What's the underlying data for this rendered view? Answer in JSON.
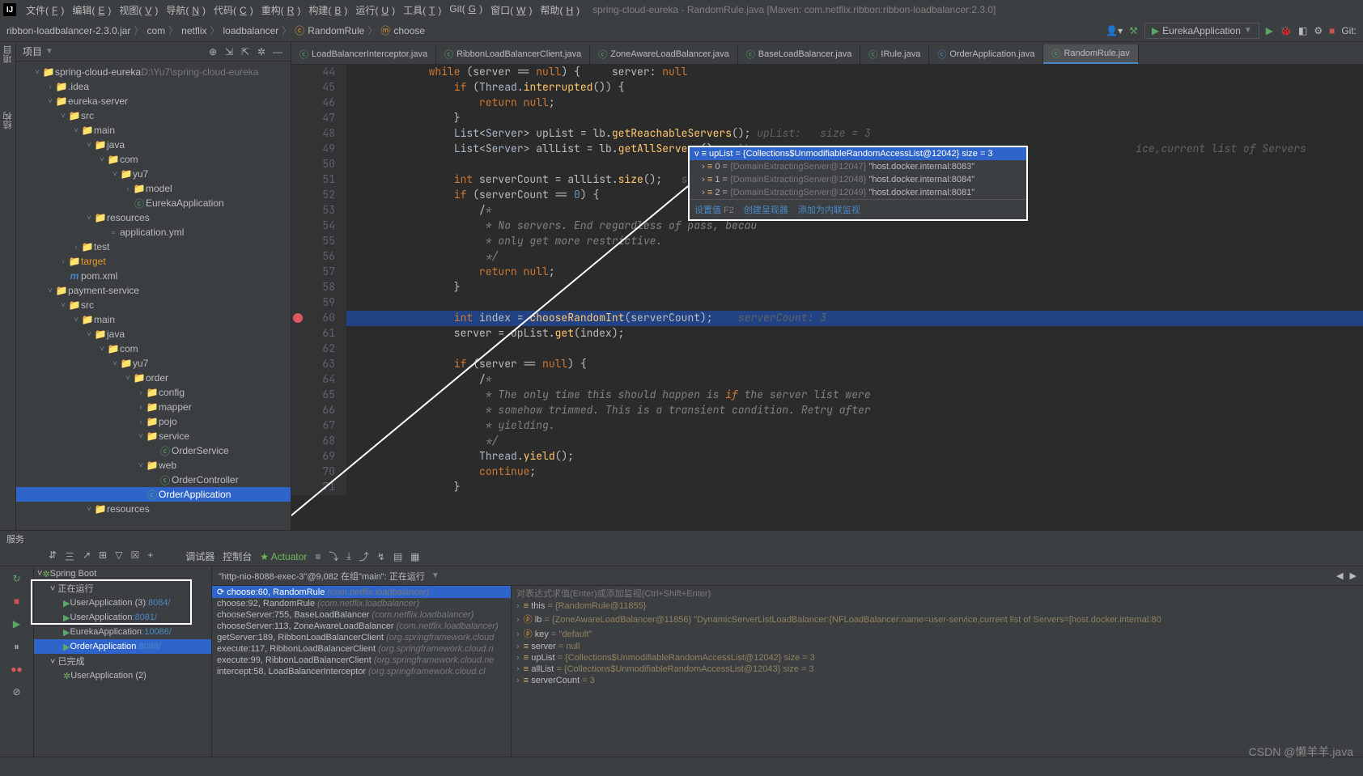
{
  "title": "spring-cloud-eureka - RandomRule.java [Maven: com.netflix.ribbon:ribbon-loadbalancer:2.3.0]",
  "menus": [
    {
      "label": "文件",
      "u": "F"
    },
    {
      "label": "编辑",
      "u": "E"
    },
    {
      "label": "视图",
      "u": "V"
    },
    {
      "label": "导航",
      "u": "N"
    },
    {
      "label": "代码",
      "u": "C"
    },
    {
      "label": "重构",
      "u": "R"
    },
    {
      "label": "构建",
      "u": "B"
    },
    {
      "label": "运行",
      "u": "U"
    },
    {
      "label": "工具",
      "u": "T"
    },
    {
      "label": "Git",
      "u": "G"
    },
    {
      "label": "窗口",
      "u": "W"
    },
    {
      "label": "帮助",
      "u": "H"
    }
  ],
  "breadcrumbs": [
    "ribbon-loadbalancer-2.3.0.jar",
    "com",
    "netflix",
    "loadbalancer",
    "RandomRule",
    "choose"
  ],
  "run_config": "EurekaApplication",
  "nav_right_git": "Git:",
  "project_panel_title": "项目",
  "project_root": {
    "name": "spring-cloud-eureka",
    "path": "D:\\Yu7\\spring-cloud-eureka"
  },
  "tree": [
    {
      "ind": 0,
      "arr": "v",
      "icon": "folder-blue",
      "label": "spring-cloud-eureka",
      "suffix": "D:\\Yu7\\spring-cloud-eureka"
    },
    {
      "ind": 1,
      "arr": ">",
      "icon": "folder",
      "label": ".idea"
    },
    {
      "ind": 1,
      "arr": "v",
      "icon": "folder-blue",
      "label": "eureka-server"
    },
    {
      "ind": 2,
      "arr": "v",
      "icon": "folder",
      "label": "src"
    },
    {
      "ind": 3,
      "arr": "v",
      "icon": "folder-blue",
      "label": "main"
    },
    {
      "ind": 4,
      "arr": "v",
      "icon": "folder-blue",
      "label": "java"
    },
    {
      "ind": 5,
      "arr": "v",
      "icon": "folder",
      "label": "com"
    },
    {
      "ind": 6,
      "arr": "v",
      "icon": "folder",
      "label": "yu7"
    },
    {
      "ind": 7,
      "arr": ">",
      "icon": "folder",
      "label": "model"
    },
    {
      "ind": 7,
      "arr": "",
      "icon": "class-run",
      "label": "EurekaApplication"
    },
    {
      "ind": 4,
      "arr": "v",
      "icon": "folder-blue",
      "label": "resources"
    },
    {
      "ind": 5,
      "arr": "",
      "icon": "file",
      "label": "application.yml"
    },
    {
      "ind": 3,
      "arr": ">",
      "icon": "folder",
      "label": "test"
    },
    {
      "ind": 2,
      "arr": ">",
      "icon": "folder-orange",
      "label": "target",
      "hl": "orange"
    },
    {
      "ind": 2,
      "arr": "",
      "icon": "file-m",
      "label": "pom.xml"
    },
    {
      "ind": 1,
      "arr": "v",
      "icon": "folder-blue",
      "label": "payment-service"
    },
    {
      "ind": 2,
      "arr": "v",
      "icon": "folder",
      "label": "src"
    },
    {
      "ind": 3,
      "arr": "v",
      "icon": "folder-blue",
      "label": "main"
    },
    {
      "ind": 4,
      "arr": "v",
      "icon": "folder-blue",
      "label": "java"
    },
    {
      "ind": 5,
      "arr": "v",
      "icon": "folder",
      "label": "com"
    },
    {
      "ind": 6,
      "arr": "v",
      "icon": "folder",
      "label": "yu7"
    },
    {
      "ind": 7,
      "arr": "v",
      "icon": "folder",
      "label": "order"
    },
    {
      "ind": 8,
      "arr": ">",
      "icon": "folder",
      "label": "config"
    },
    {
      "ind": 8,
      "arr": ">",
      "icon": "folder",
      "label": "mapper"
    },
    {
      "ind": 8,
      "arr": ">",
      "icon": "folder",
      "label": "pojo"
    },
    {
      "ind": 8,
      "arr": "v",
      "icon": "folder",
      "label": "service"
    },
    {
      "ind": 9,
      "arr": "",
      "icon": "class",
      "label": "OrderService"
    },
    {
      "ind": 8,
      "arr": "v",
      "icon": "folder",
      "label": "web"
    },
    {
      "ind": 9,
      "arr": "",
      "icon": "class",
      "label": "OrderController"
    },
    {
      "ind": 8,
      "arr": "",
      "icon": "class-run",
      "label": "OrderApplication",
      "sel": true
    },
    {
      "ind": 4,
      "arr": "v",
      "icon": "folder-blue",
      "label": "resources"
    }
  ],
  "tabs": [
    {
      "label": "LoadBalancerInterceptor.java",
      "icon": "c",
      "color": "#59A869"
    },
    {
      "label": "RibbonLoadBalancerClient.java",
      "icon": "c",
      "color": "#59A869"
    },
    {
      "label": "ZoneAwareLoadBalancer.java",
      "icon": "c",
      "color": "#59A869"
    },
    {
      "label": "BaseLoadBalancer.java",
      "icon": "c",
      "color": "#59A869"
    },
    {
      "label": "IRule.java",
      "icon": "i",
      "color": "#59A869"
    },
    {
      "label": "OrderApplication.java",
      "icon": "c",
      "color": "#4A88C7"
    },
    {
      "label": "RandomRule.jav",
      "icon": "c",
      "color": "#59A869",
      "active": true
    }
  ],
  "code_inline_hint_line48": "upList:   size = 3",
  "code_inline_hint_line51": "serverCount:",
  "code_inline_hint_line60": "serverCount: 3",
  "code_trailing_line49": "ice,current list of Servers",
  "code": [
    {
      "n": 44,
      "t": "            while (server == null) {     server: null"
    },
    {
      "n": 45,
      "t": "                if (Thread.interrupted()) {"
    },
    {
      "n": 46,
      "t": "                    return null;"
    },
    {
      "n": 47,
      "t": "                }"
    },
    {
      "n": 48,
      "t": "                List<Server> upList = lb.getReachableServers();"
    },
    {
      "n": 49,
      "t": "                List<Server> allList = lb.getAllServers();   lb:"
    },
    {
      "n": 50,
      "t": ""
    },
    {
      "n": 51,
      "t": "                int serverCount = allList.size();"
    },
    {
      "n": 52,
      "t": "                if (serverCount == 0) {"
    },
    {
      "n": 53,
      "t": "                    /*"
    },
    {
      "n": 54,
      "t": "                     * No servers. End regardless of pass, becau"
    },
    {
      "n": 55,
      "t": "                     * only get more restrictive."
    },
    {
      "n": 56,
      "t": "                     */"
    },
    {
      "n": 57,
      "t": "                    return null;"
    },
    {
      "n": 58,
      "t": "                }"
    },
    {
      "n": 59,
      "t": ""
    },
    {
      "n": 60,
      "t": "                int index = chooseRandomInt(serverCount);",
      "hl": true,
      "bp": true
    },
    {
      "n": 61,
      "t": "                server = upList.get(index);"
    },
    {
      "n": 62,
      "t": ""
    },
    {
      "n": 63,
      "t": "                if (server == null) {"
    },
    {
      "n": 64,
      "t": "                    /*"
    },
    {
      "n": 65,
      "t": "                     * The only time this should happen is if the server list were"
    },
    {
      "n": 66,
      "t": "                     * somehow trimmed. This is a transient condition. Retry after"
    },
    {
      "n": 67,
      "t": "                     * yielding."
    },
    {
      "n": 68,
      "t": "                     */"
    },
    {
      "n": 69,
      "t": "                    Thread.yield();"
    },
    {
      "n": 70,
      "t": "                    continue;"
    },
    {
      "n": 71,
      "t": "                }"
    }
  ],
  "popup": {
    "header": "upList = {Collections$UnmodifiableRandomAccessList@12042}  size = 3",
    "items": [
      {
        "key": "0",
        "type": "{DomainExtractingServer@12047}",
        "val": "\"host.docker.internal:8083\""
      },
      {
        "key": "1",
        "type": "{DomainExtractingServer@12048}",
        "val": "\"host.docker.internal:8084\""
      },
      {
        "key": "2",
        "type": "{DomainExtractingServer@12049}",
        "val": "\"host.docker.internal:8081\""
      }
    ],
    "actions": [
      "设置值",
      "创建呈现器",
      "添加为内联监视"
    ],
    "action_hint": "F2"
  },
  "bottom_title": "服务",
  "debugger_tabs": [
    "调试器",
    "控制台",
    "Actuator"
  ],
  "services_toolbar_row": [
    "⇵",
    "三",
    "↗",
    "⊞",
    "▽",
    "☒",
    "+"
  ],
  "services": [
    {
      "ind": 0,
      "arr": "v",
      "icon": "leaf",
      "label": "Spring Boot"
    },
    {
      "ind": 1,
      "arr": "v",
      "icon": "",
      "label": "正在运行",
      "box": true
    },
    {
      "ind": 2,
      "arr": "",
      "icon": "play",
      "label": "UserApplication (3)",
      "port": ":8084/",
      "box": true
    },
    {
      "ind": 2,
      "arr": "",
      "icon": "play",
      "label": "UserApplication",
      "port": ":8081/",
      "box": true
    },
    {
      "ind": 2,
      "arr": "",
      "icon": "play",
      "label": "EurekaApplication",
      "port": ":10086/"
    },
    {
      "ind": 2,
      "arr": "",
      "icon": "play",
      "label": "OrderApplication",
      "port": ":8088/",
      "sel": true
    },
    {
      "ind": 1,
      "arr": "v",
      "icon": "",
      "label": "已完成"
    },
    {
      "ind": 2,
      "arr": "",
      "icon": "leaf",
      "label": "UserApplication (2)"
    }
  ],
  "thread_info": "\"http-nio-8088-exec-3\"@9,082 在组\"main\": 正在运行",
  "frames": [
    {
      "label": "choose:60, RandomRule",
      "pkg": "(com.netflix.loadbalancer)",
      "sel": true
    },
    {
      "label": "choose:92, RandomRule",
      "pkg": "(com.netflix.loadbalancer)"
    },
    {
      "label": "chooseServer:755, BaseLoadBalancer",
      "pkg": "(com.netflix.loadbalancer)"
    },
    {
      "label": "chooseServer:113, ZoneAwareLoadBalancer",
      "pkg": "(com.netflix.loadbalancer)"
    },
    {
      "label": "getServer:189, RibbonLoadBalancerClient",
      "pkg": "(org.springframework.cloud"
    },
    {
      "label": "execute:117, RibbonLoadBalancerClient",
      "pkg": "(org.springframework.cloud.n"
    },
    {
      "label": "execute:99, RibbonLoadBalancerClient",
      "pkg": "(org.springframework.cloud.ne"
    },
    {
      "label": "intercept:58, LoadBalancerInterceptor",
      "pkg": "(org.springframework.cloud.cl"
    }
  ],
  "vars_header": "对表达式求值(Enter)或添加监视(Ctrl+Shift+Enter)",
  "vars": [
    {
      "icon": "equals",
      "name": "this",
      "val": "= {RandomRule@11855}"
    },
    {
      "icon": "p-orange",
      "name": "lb",
      "val": "= {ZoneAwareLoadBalancer@11856} \"DynamicServerListLoadBalancer:{NFLoadBalancer:name=user-service,current list of Servers=[host.docker.internal:80"
    },
    {
      "icon": "p-orange",
      "name": "key",
      "val": "= \"default\""
    },
    {
      "icon": "equals",
      "name": "server",
      "val": "= null"
    },
    {
      "icon": "equals",
      "name": "upList",
      "val": "= {Collections$UnmodifiableRandomAccessList@12042}  size = 3"
    },
    {
      "icon": "equals",
      "name": "allList",
      "val": "= {Collections$UnmodifiableRandomAccessList@12043}  size = 3"
    },
    {
      "icon": "equals",
      "name": "serverCount",
      "val": "= 3"
    }
  ],
  "watermark": "CSDN @懒羊羊.java"
}
